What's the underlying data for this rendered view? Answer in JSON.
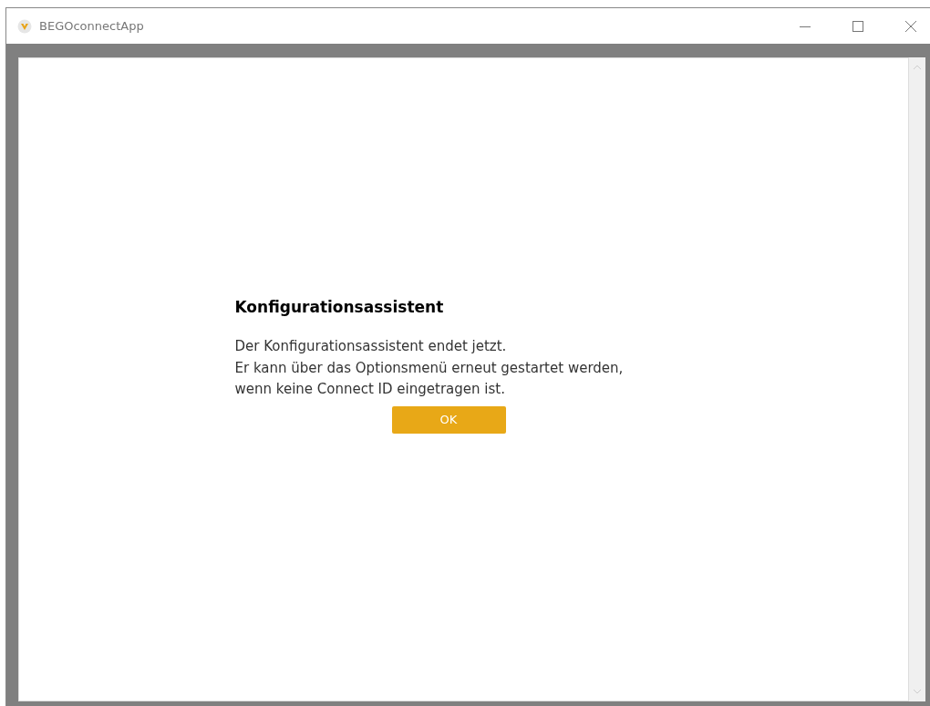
{
  "window": {
    "title": "BEGOconnectApp"
  },
  "dialog": {
    "title": "Konfigurationsassistent",
    "message_lines": [
      "Der Konfigurationsassistent endet jetzt.",
      "Er kann über das Optionsmenü erneut gestartet werden,",
      "wenn keine Connect ID eingetragen ist."
    ],
    "button": "OK"
  }
}
